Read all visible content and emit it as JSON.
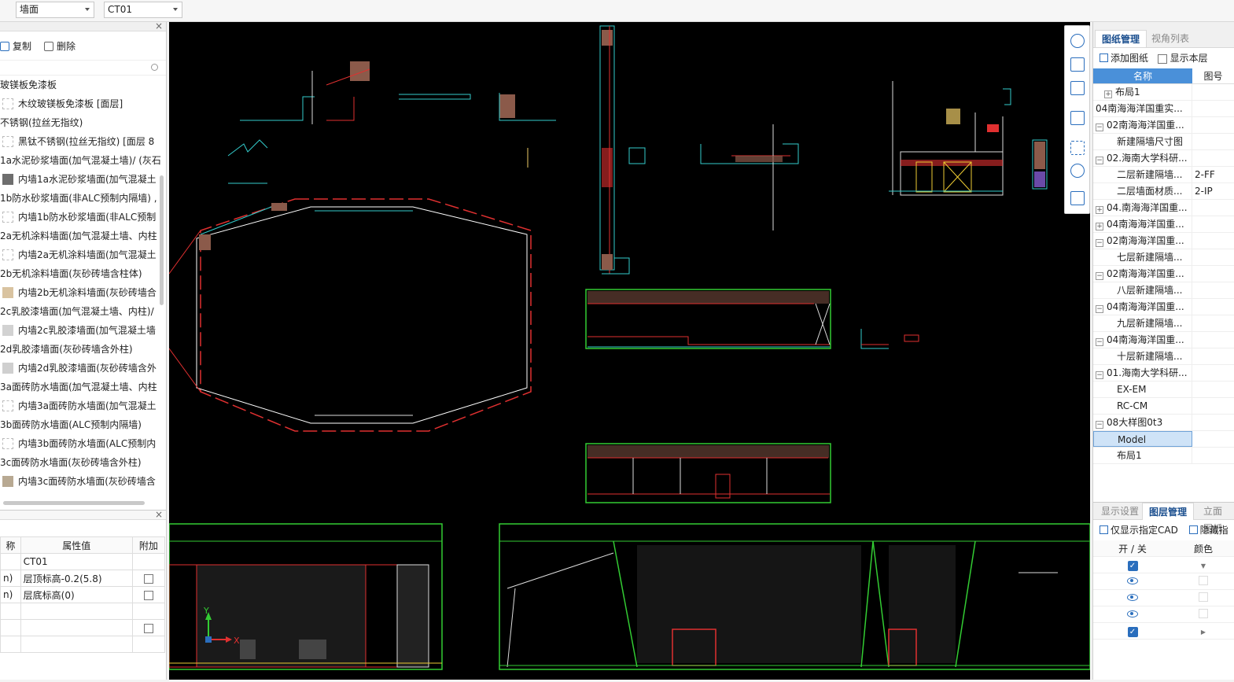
{
  "toolbar": {
    "type_select": "墙面",
    "code_select": "CT01"
  },
  "left_panel": {
    "copy_label": "复制",
    "delete_label": "删除",
    "tree": [
      {
        "label": "玻镁板免漆板",
        "child": false,
        "swatch": ""
      },
      {
        "label": "木纹玻镁板免漆板 [面层]",
        "child": true,
        "swatch": "none"
      },
      {
        "label": "不锈钢(拉丝无指纹)",
        "child": false,
        "swatch": ""
      },
      {
        "label": "黑钛不锈钢(拉丝无指纹) [面层 8",
        "child": true,
        "swatch": "none"
      },
      {
        "label": "1a水泥砂浆墙面(加气混凝土墙)/ (灰石",
        "child": false,
        "swatch": ""
      },
      {
        "label": "内墙1a水泥砂浆墙面(加气混凝土",
        "child": true,
        "swatch": "#6e6e6e"
      },
      {
        "label": "1b防水砂浆墙面(非ALC预制内隔墙) ,",
        "child": false,
        "swatch": ""
      },
      {
        "label": "内墙1b防水砂浆墙面(非ALC预制",
        "child": true,
        "swatch": "none"
      },
      {
        "label": "2a无机涂料墙面(加气混凝土墙、内柱",
        "child": false,
        "swatch": ""
      },
      {
        "label": "内墙2a无机涂料墙面(加气混凝土",
        "child": true,
        "swatch": "none"
      },
      {
        "label": "2b无机涂料墙面(灰砂砖墙含柱体)",
        "child": false,
        "swatch": ""
      },
      {
        "label": "内墙2b无机涂料墙面(灰砂砖墙合",
        "child": true,
        "swatch": "#d9c3a0"
      },
      {
        "label": "2c乳胶漆墙面(加气混凝土墙、内柱)/",
        "child": false,
        "swatch": ""
      },
      {
        "label": "内墙2c乳胶漆墙面(加气混凝土墙",
        "child": true,
        "swatch": "#d2d2d2"
      },
      {
        "label": "2d乳胶漆墙面(灰砂砖墙含外柱)",
        "child": false,
        "swatch": ""
      },
      {
        "label": "内墙2d乳胶漆墙面(灰砂砖墙含外",
        "child": true,
        "swatch": "#cfcfcf"
      },
      {
        "label": "3a面砖防水墙面(加气混凝土墙、内柱",
        "child": false,
        "swatch": ""
      },
      {
        "label": "内墙3a面砖防水墙面(加气混凝土",
        "child": true,
        "swatch": "none"
      },
      {
        "label": "3b面砖防水墙面(ALC预制内隔墙)",
        "child": false,
        "swatch": ""
      },
      {
        "label": "内墙3b面砖防水墙面(ALC预制内",
        "child": true,
        "swatch": "none"
      },
      {
        "label": "3c面砖防水墙面(灰砂砖墙含外柱)",
        "child": false,
        "swatch": ""
      },
      {
        "label": "内墙3c面砖防水墙面(灰砂砖墙含",
        "child": true,
        "swatch": "#b8a992"
      }
    ]
  },
  "properties": {
    "headers": [
      "称",
      "属性值",
      "附加"
    ],
    "rows": [
      {
        "name": "",
        "value": "CT01",
        "check": false,
        "show_check": false
      },
      {
        "name": "n)",
        "value": "层顶标高-0.2(5.8)",
        "check": false,
        "show_check": true
      },
      {
        "name": "n)",
        "value": "层底标高(0)",
        "check": false,
        "show_check": true
      },
      {
        "name": "",
        "value": "",
        "check": false,
        "show_check": false
      },
      {
        "name": "",
        "value": "",
        "check": false,
        "show_check": true
      },
      {
        "name": "",
        "value": "",
        "check": false,
        "show_check": false
      }
    ]
  },
  "canvas": {
    "axis_x": "X",
    "axis_y": "Y"
  },
  "right_panel": {
    "tab_drawings": "图纸管理",
    "tab_views": "视角列表",
    "add_drawing": "添加图纸",
    "show_this_floor": "显示本层",
    "col_name": "名称",
    "col_number": "图号",
    "rows": [
      {
        "label": "布局1",
        "expander": "+",
        "indent": 1,
        "number": ""
      },
      {
        "label": "04南海海洋国重实...",
        "expander": "",
        "indent": 0,
        "number": ""
      },
      {
        "label": "02南海海洋国重...",
        "expander": "-",
        "indent": 0,
        "number": ""
      },
      {
        "label": "新建隔墙尺寸图",
        "expander": "",
        "indent": 2,
        "number": ""
      },
      {
        "label": "02.海南大学科研...",
        "expander": "-",
        "indent": 0,
        "number": ""
      },
      {
        "label": "二层新建隔墙...",
        "expander": "",
        "indent": 2,
        "number": "2-FF"
      },
      {
        "label": "二层墙面材质...",
        "expander": "",
        "indent": 2,
        "number": "2-IP"
      },
      {
        "label": "04.南海海洋国重...",
        "expander": "+",
        "indent": 0,
        "number": ""
      },
      {
        "label": "04南海海洋国重...",
        "expander": "+",
        "indent": 0,
        "number": ""
      },
      {
        "label": "02南海海洋国重...",
        "expander": "-",
        "indent": 0,
        "number": ""
      },
      {
        "label": "七层新建隔墙...",
        "expander": "",
        "indent": 2,
        "number": ""
      },
      {
        "label": "02南海海洋国重...",
        "expander": "-",
        "indent": 0,
        "number": ""
      },
      {
        "label": "八层新建隔墙...",
        "expander": "",
        "indent": 2,
        "number": ""
      },
      {
        "label": "04南海海洋国重...",
        "expander": "-",
        "indent": 0,
        "number": ""
      },
      {
        "label": "九层新建隔墙...",
        "expander": "",
        "indent": 2,
        "number": ""
      },
      {
        "label": "04南海海洋国重...",
        "expander": "-",
        "indent": 0,
        "number": ""
      },
      {
        "label": "十层新建隔墙...",
        "expander": "",
        "indent": 2,
        "number": ""
      },
      {
        "label": "01.海南大学科研...",
        "expander": "-",
        "indent": 0,
        "number": ""
      },
      {
        "label": "EX-EM",
        "expander": "",
        "indent": 2,
        "number": ""
      },
      {
        "label": "RC-CM",
        "expander": "",
        "indent": 2,
        "number": ""
      },
      {
        "label": "08大样图0t3",
        "expander": "-",
        "indent": 0,
        "number": ""
      },
      {
        "label": "Model",
        "expander": "",
        "indent": 2,
        "number": "",
        "selected": true
      },
      {
        "label": "布局1",
        "expander": "",
        "indent": 2,
        "number": ""
      }
    ],
    "tab_display": "显示设置",
    "tab_layers": "图层管理",
    "tab_elevation": "立面图纸",
    "only_cad": "仅显示指定CAD",
    "hide_label": "隐藏指",
    "layer_col_onoff": "开 / 关",
    "layer_col_color": "颜色"
  }
}
